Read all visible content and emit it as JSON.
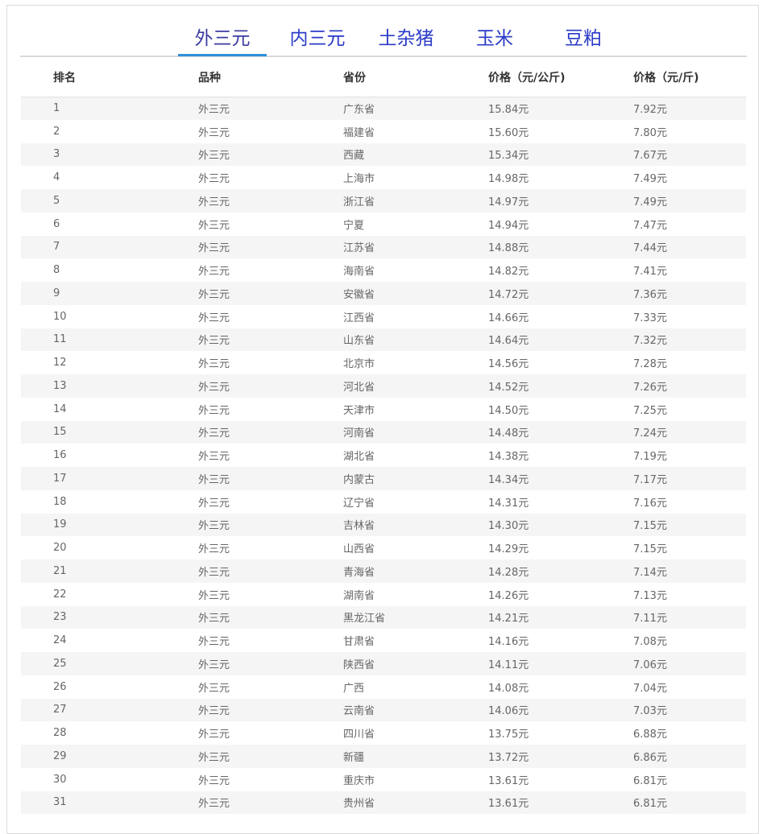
{
  "tabs": [
    {
      "label": "外三元",
      "active": true
    },
    {
      "label": "内三元",
      "active": false
    },
    {
      "label": "土杂猪",
      "active": false
    },
    {
      "label": "玉米",
      "active": false
    },
    {
      "label": "豆粕",
      "active": false
    }
  ],
  "table": {
    "headers": [
      "排名",
      "品种",
      "省份",
      "价格（元/公斤)",
      "价格（元/斤)"
    ],
    "rows": [
      [
        "1",
        "外三元",
        "广东省",
        "15.84元",
        "7.92元"
      ],
      [
        "2",
        "外三元",
        "福建省",
        "15.60元",
        "7.80元"
      ],
      [
        "3",
        "外三元",
        "西藏",
        "15.34元",
        "7.67元"
      ],
      [
        "4",
        "外三元",
        "上海市",
        "14.98元",
        "7.49元"
      ],
      [
        "5",
        "外三元",
        "浙江省",
        "14.97元",
        "7.49元"
      ],
      [
        "6",
        "外三元",
        "宁夏",
        "14.94元",
        "7.47元"
      ],
      [
        "7",
        "外三元",
        "江苏省",
        "14.88元",
        "7.44元"
      ],
      [
        "8",
        "外三元",
        "海南省",
        "14.82元",
        "7.41元"
      ],
      [
        "9",
        "外三元",
        "安徽省",
        "14.72元",
        "7.36元"
      ],
      [
        "10",
        "外三元",
        "江西省",
        "14.66元",
        "7.33元"
      ],
      [
        "11",
        "外三元",
        "山东省",
        "14.64元",
        "7.32元"
      ],
      [
        "12",
        "外三元",
        "北京市",
        "14.56元",
        "7.28元"
      ],
      [
        "13",
        "外三元",
        "河北省",
        "14.52元",
        "7.26元"
      ],
      [
        "14",
        "外三元",
        "天津市",
        "14.50元",
        "7.25元"
      ],
      [
        "15",
        "外三元",
        "河南省",
        "14.48元",
        "7.24元"
      ],
      [
        "16",
        "外三元",
        "湖北省",
        "14.38元",
        "7.19元"
      ],
      [
        "17",
        "外三元",
        "内蒙古",
        "14.34元",
        "7.17元"
      ],
      [
        "18",
        "外三元",
        "辽宁省",
        "14.31元",
        "7.16元"
      ],
      [
        "19",
        "外三元",
        "吉林省",
        "14.30元",
        "7.15元"
      ],
      [
        "20",
        "外三元",
        "山西省",
        "14.29元",
        "7.15元"
      ],
      [
        "21",
        "外三元",
        "青海省",
        "14.28元",
        "7.14元"
      ],
      [
        "22",
        "外三元",
        "湖南省",
        "14.26元",
        "7.13元"
      ],
      [
        "23",
        "外三元",
        "黑龙江省",
        "14.21元",
        "7.11元"
      ],
      [
        "24",
        "外三元",
        "甘肃省",
        "14.16元",
        "7.08元"
      ],
      [
        "25",
        "外三元",
        "陕西省",
        "14.11元",
        "7.06元"
      ],
      [
        "26",
        "外三元",
        "广西",
        "14.08元",
        "7.04元"
      ],
      [
        "27",
        "外三元",
        "云南省",
        "14.06元",
        "7.03元"
      ],
      [
        "28",
        "外三元",
        "四川省",
        "13.75元",
        "6.88元"
      ],
      [
        "29",
        "外三元",
        "新疆",
        "13.72元",
        "6.86元"
      ],
      [
        "30",
        "外三元",
        "重庆市",
        "13.61元",
        "6.81元"
      ],
      [
        "31",
        "外三元",
        "贵州省",
        "13.61元",
        "6.81元"
      ]
    ]
  }
}
